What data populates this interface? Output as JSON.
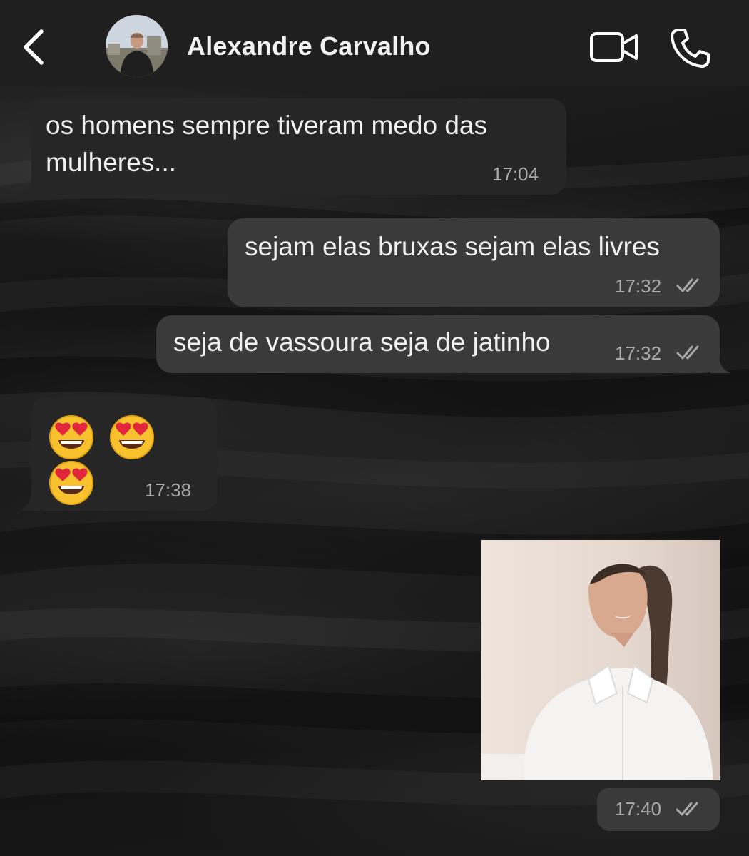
{
  "header": {
    "contact_name": "Alexandre Carvalho"
  },
  "icons": {
    "back": "chevron-left-icon",
    "video": "video-camera-icon",
    "call": "phone-icon",
    "read": "double-check-icon",
    "emoji": "heart-eyes-emoji"
  },
  "colors": {
    "header_bg": "#1f1f1f",
    "incoming_bubble": "#262626",
    "outgoing_bubble": "#3a3a3a",
    "timestamp": "#a9a9a9"
  },
  "messages": [
    {
      "direction": "incoming",
      "text": "os homens sempre tiveram medo das\nmulheres...",
      "time": "17:04"
    },
    {
      "direction": "outgoing",
      "text": "sejam elas bruxas sejam elas livres",
      "time": "17:32",
      "status": "read"
    },
    {
      "direction": "outgoing",
      "text": "seja de vassoura seja de jatinho",
      "time": "17:32",
      "status": "read"
    },
    {
      "direction": "incoming",
      "emoji_count": 3,
      "time": "17:38"
    },
    {
      "direction": "outgoing",
      "type": "image",
      "time": "17:40",
      "status": "read"
    }
  ]
}
